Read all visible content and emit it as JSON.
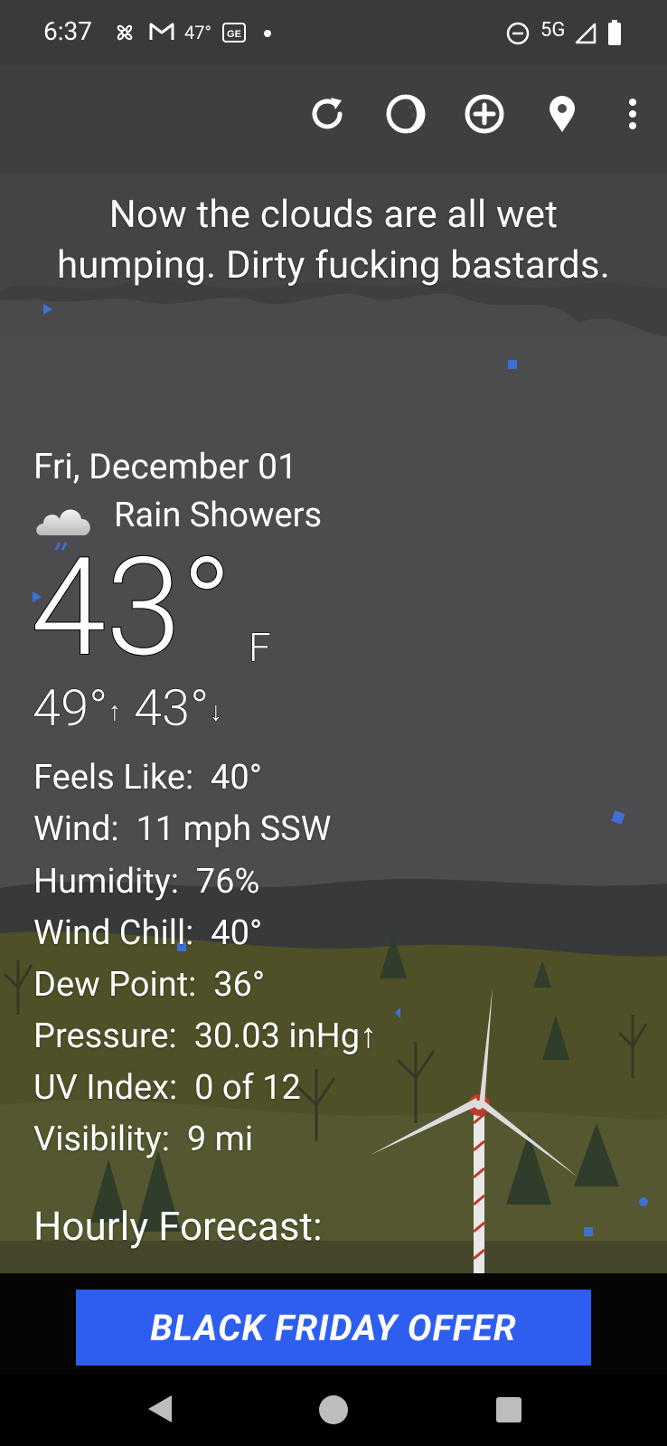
{
  "status_bar": {
    "time": "6:37",
    "temp": "47°",
    "network": "5G",
    "icons": [
      "fan-icon",
      "gmail-icon",
      "temperature-text",
      "news-icon",
      "dot-icon",
      "do-not-disturb-icon",
      "signal-icon",
      "battery-icon"
    ]
  },
  "toolbar": {
    "icons": [
      "refresh-icon",
      "theme-icon",
      "add-location-icon",
      "location-pin-icon",
      "more-vert-icon"
    ]
  },
  "headline": "Now the clouds are all wet humping. Dirty fucking bastards.",
  "weather": {
    "date": "Fri, December 01",
    "condition": "Rain Showers",
    "condition_icon": "rain-cloud-icon",
    "temperature": "43°",
    "unit": "F",
    "high": "49°",
    "low": "43°",
    "high_arrow": "↑",
    "low_arrow": "↓"
  },
  "details": [
    {
      "label": "Feels Like:",
      "value": "40°"
    },
    {
      "label": "Wind:",
      "value": "11 mph SSW"
    },
    {
      "label": "Humidity:",
      "value": "76%"
    },
    {
      "label": "Wind Chill:",
      "value": "40°"
    },
    {
      "label": "Dew Point:",
      "value": "36°"
    },
    {
      "label": "Pressure:",
      "value": "30.03 inHg↑"
    },
    {
      "label": "UV Index:",
      "value": "0 of 12"
    },
    {
      "label": "Visibility:",
      "value": "9 mi"
    }
  ],
  "hourly_title": "Hourly Forecast:",
  "ad": {
    "label": "BLACK FRIDAY OFFER",
    "color": "#2e5ef0"
  },
  "nav_bar": {
    "icons": [
      "back-icon",
      "home-icon",
      "recents-icon"
    ]
  }
}
